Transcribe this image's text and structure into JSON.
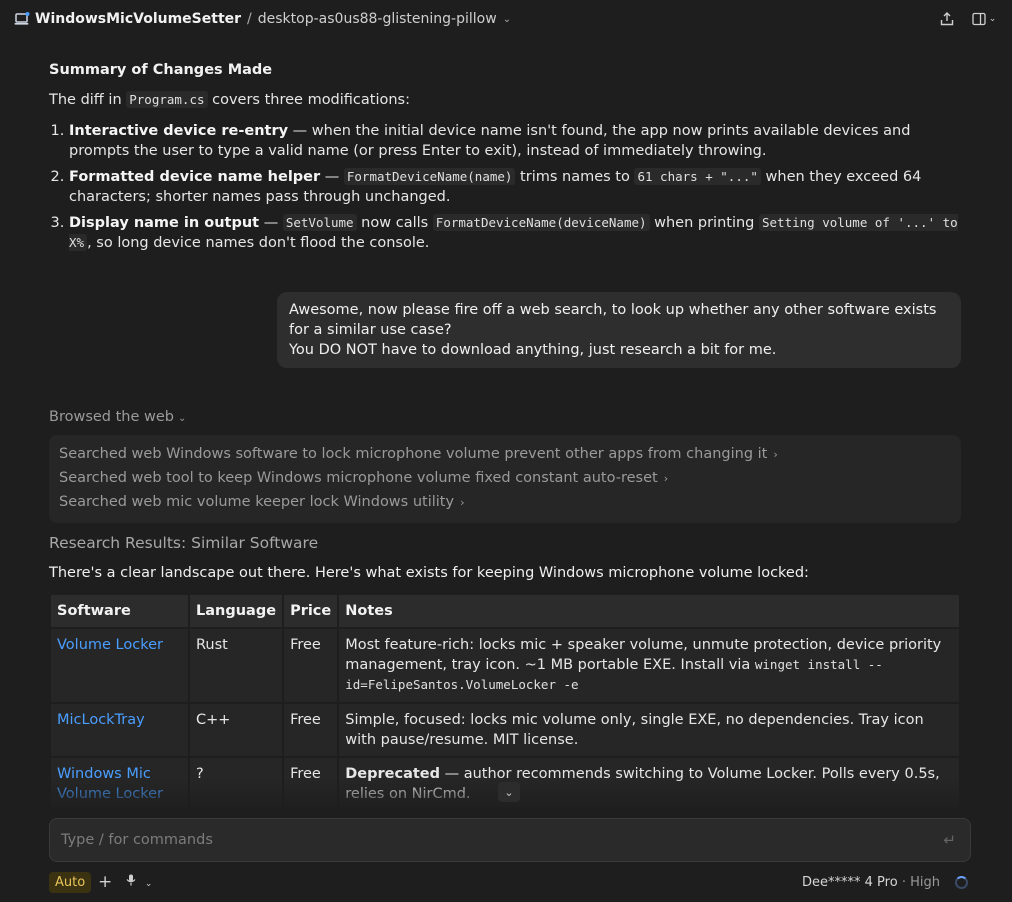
{
  "header": {
    "app_title": "WindowsMicVolumeSetter",
    "separator": "/",
    "workspace": "desktop-as0us88-glistening-pillow",
    "share_icon": "share-upload-icon",
    "panel_icon": "sidebar-panel-icon"
  },
  "summary": {
    "title": "Summary of Changes Made",
    "intro_prefix": "The diff in",
    "intro_code": "Program.cs",
    "intro_suffix": "covers three modifications:",
    "items": [
      {
        "bold": "Interactive device re-entry",
        "text": " — when the initial device name isn't found, the app now prints available devices and prompts the user to type a valid name (or press Enter to exit), instead of immediately throwing."
      },
      {
        "bold": "Formatted device name helper",
        "text1": " — ",
        "code1": "FormatDeviceName(name)",
        "text2": " trims names to ",
        "code2": "61 chars + \"...\"",
        "text3": " when they exceed 64 characters; shorter names pass through unchanged."
      },
      {
        "bold": "Display name in output",
        "text1": " — ",
        "code1": "SetVolume",
        "text2": " now calls ",
        "code2": "FormatDeviceName(deviceName)",
        "text3": " when printing ",
        "code3": "Setting volume of '...' to X%",
        "text4": ", so long device names don't flood the console."
      }
    ]
  },
  "user_message": {
    "line1": "Awesome, now please fire off a web search, to look up whether any other software exists for a similar use case?",
    "line2": "You DO NOT have to download anything, just research a bit for me."
  },
  "browsed": {
    "label": "Browsed the web",
    "searches": [
      "Searched web Windows software to lock microphone volume prevent other apps from changing it",
      "Searched web tool to keep Windows microphone volume fixed constant auto-reset",
      "Searched web mic volume keeper lock Windows utility"
    ]
  },
  "research": {
    "title": "Research Results: Similar Software",
    "intro": "There's a clear landscape out there. Here's what exists for keeping Windows microphone volume locked:",
    "columns": [
      "Software",
      "Language",
      "Price",
      "Notes"
    ],
    "rows": [
      {
        "software": "Volume Locker",
        "language": "Rust",
        "price": "Free",
        "notes": "Most feature-rich: locks mic + speaker volume, unmute protection, device priority management, tray icon. ~1 MB portable EXE. Install via ",
        "notes_code": "winget install --id=FelipeSantos.VolumeLocker -e"
      },
      {
        "software": "MicLockTray",
        "language": "C++",
        "price": "Free",
        "notes": "Simple, focused: locks mic volume only, single EXE, no dependencies. Tray icon with pause/resume. MIT license."
      },
      {
        "software": "Windows Mic Volume Locker",
        "language": "?",
        "price": "Free",
        "notes_bold": "Deprecated",
        "notes": " — author recommends switching to Volume Locker. Polls every 0.5s, relies on NirCmd."
      }
    ]
  },
  "composer": {
    "placeholder": "Type / for commands"
  },
  "footer": {
    "mode": "Auto",
    "model": "Dee***** 4 Pro",
    "effort": "High",
    "sep": "·"
  }
}
